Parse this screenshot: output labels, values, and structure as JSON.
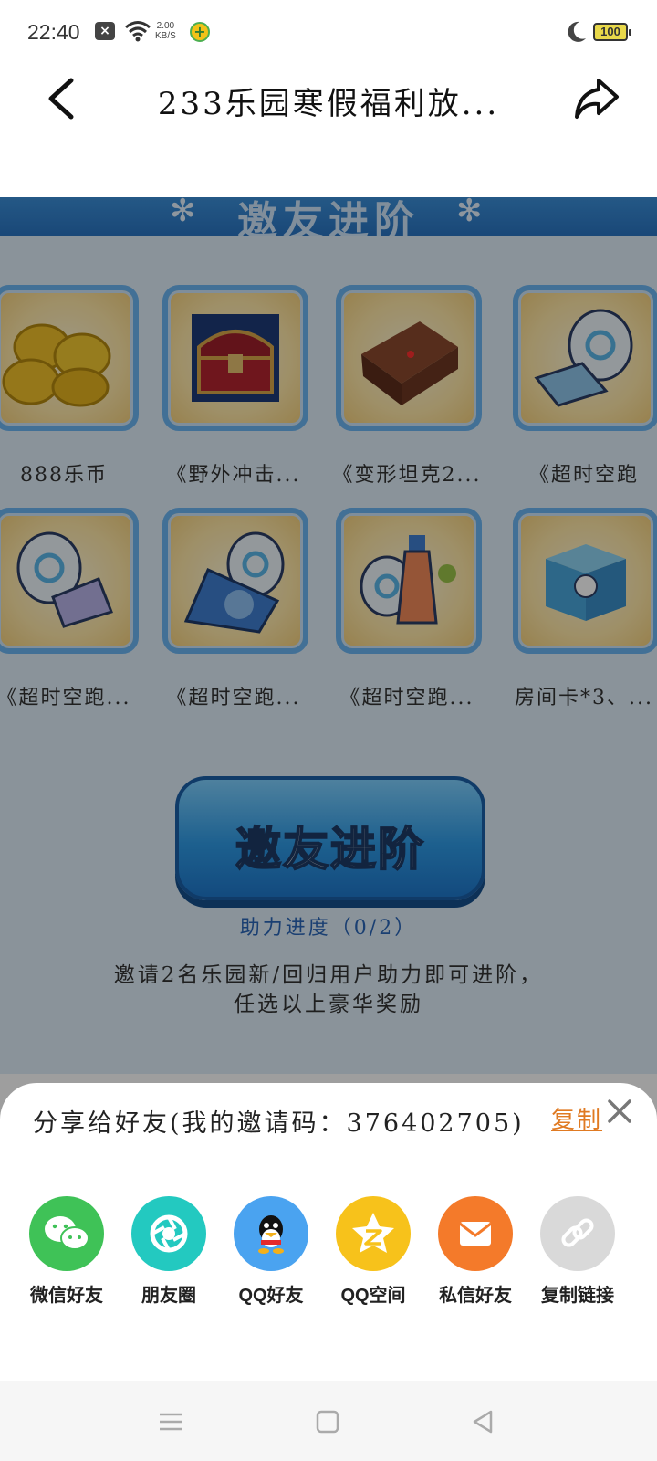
{
  "status_bar": {
    "time": "22:40",
    "network_speed_value": "2.00",
    "network_speed_unit": "KB/S",
    "battery": "100"
  },
  "header": {
    "title": "233乐园寒假福利放..."
  },
  "game": {
    "banner_title": "邀友进阶",
    "prizes": [
      {
        "label": "888乐币",
        "icon": "coins-icon"
      },
      {
        "label": "《野外冲击...",
        "icon": "treasure-chest-icon"
      },
      {
        "label": "《变形坦克2...",
        "icon": "gift-box-icon"
      },
      {
        "label": "《超时空跑",
        "icon": "book-egg-icon"
      },
      {
        "label": "《超时空跑...",
        "icon": "candy-egg-icon"
      },
      {
        "label": "《超时空跑...",
        "icon": "cape-egg-icon"
      },
      {
        "label": "《超时空跑...",
        "icon": "potion-egg-icon"
      },
      {
        "label": "房间卡*3、...",
        "icon": "blue-box-icon"
      }
    ],
    "invite_button": "邀友进阶",
    "progress": "助力进度（0/2）",
    "description_line1": "邀请2名乐园新/回归用户助力即可进阶，",
    "description_line2": "任选以上豪华奖励"
  },
  "share_sheet": {
    "title": "分享给好友(我的邀请码：376402705)",
    "copy_label": "复制",
    "items": [
      {
        "label": "微信好友",
        "icon": "wechat-icon",
        "color": "#3fc257"
      },
      {
        "label": "朋友圈",
        "icon": "moments-icon",
        "color": "#23c9c0"
      },
      {
        "label": "QQ好友",
        "icon": "qq-icon",
        "color": "#4aa3f0"
      },
      {
        "label": "QQ空间",
        "icon": "qzone-icon",
        "color": "#f7c21b"
      },
      {
        "label": "私信好友",
        "icon": "mail-icon",
        "color": "#f47a2a"
      },
      {
        "label": "复制链接",
        "icon": "link-icon",
        "color": "#d9d9d9"
      }
    ]
  }
}
